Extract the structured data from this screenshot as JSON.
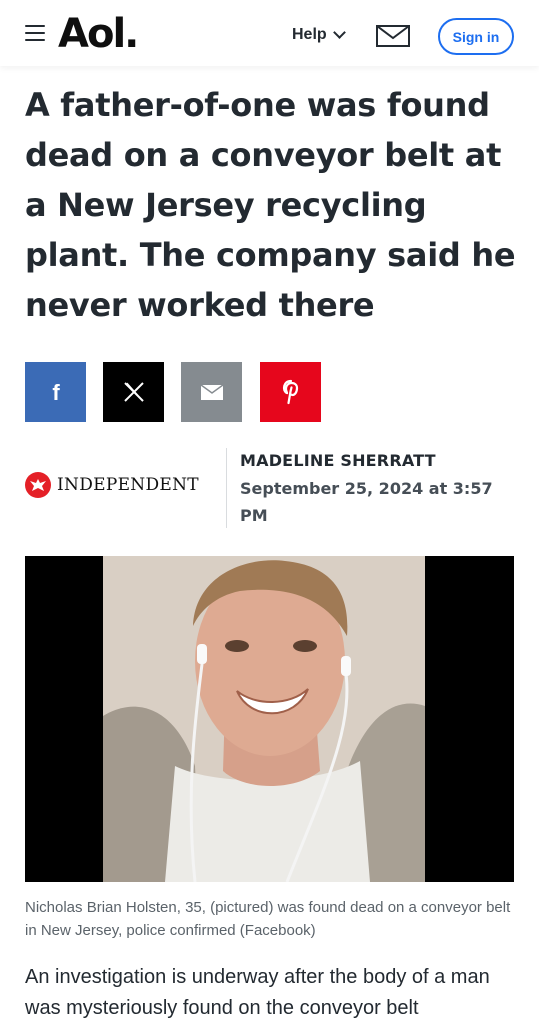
{
  "header": {
    "logo": "Aol.",
    "help_label": "Help",
    "signin_label": "Sign in"
  },
  "article": {
    "headline": "A father-of-one was found dead on a conveyor belt at a New Jersey recycling plant. The company said he never worked there",
    "share": [
      {
        "name": "facebook",
        "icon": "f",
        "color": "#3b6bb6"
      },
      {
        "name": "x",
        "icon": "x-logo",
        "color": "#000000"
      },
      {
        "name": "email",
        "icon": "envelope",
        "color": "#858b90"
      },
      {
        "name": "pinterest",
        "icon": "p",
        "color": "#e6061c"
      }
    ],
    "source": "INDEPENDENT",
    "author": "MADELINE SHERRATT",
    "date": "September 25, 2024 at 3:57 PM",
    "caption": "Nicholas Brian Holsten, 35, (pictured) was found dead on a conveyor belt in New Jersey, police confirmed (Facebook)",
    "body": "An investigation is underway after the body of a man was mysteriously found on the conveyor belt"
  },
  "colors": {
    "accent": "#1d6ef0",
    "text": "#232a31"
  }
}
